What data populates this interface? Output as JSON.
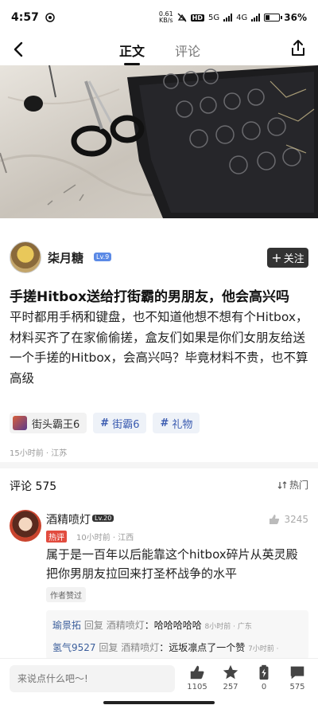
{
  "status_bar": {
    "time": "4:57",
    "net_speed_value": "0.61",
    "net_speed_unit": "KB/s",
    "hd": "HD",
    "sig1": "5G",
    "sig2": "4G",
    "battery": "36%",
    "battery_level": 0.36
  },
  "nav": {
    "tab_active": "正文",
    "tab_inactive": "评论"
  },
  "author": {
    "name": "柒月糖",
    "level": "Lv.9",
    "follow_label": "关注"
  },
  "article": {
    "title": "手搓Hitbox送给打街霸的男朋友，他会高兴吗",
    "body": "平时都用手柄和键盘，也不知道他想不想有个Hitbox，材料买齐了在家偷偷搓，盒友们如果是你们女朋友给送一个手搓的Hitbox，会高兴吗？毕竟材料不贵，也不算高级"
  },
  "tags": {
    "game": "街头霸王6",
    "tag1": "街霸6",
    "tag2": "礼物"
  },
  "post_meta": "15小时前 · 江苏",
  "comments_header": {
    "title": "评论 575",
    "sort": "热门"
  },
  "comment": {
    "user": "酒精喷灯",
    "level": "Lv.20",
    "hot_label": "热评",
    "meta": "10小时前 · 江西",
    "likes": "3245",
    "text": "属于是一百年以后能靠这个hitbox碎片从英灵殿把你男朋友拉回来打圣杯战争的水平",
    "author_liked": "作者赞过"
  },
  "replies": [
    {
      "user": "瑜景拓",
      "verb": "回复",
      "target": "酒精喷灯",
      "text": "：哈哈哈哈哈",
      "meta": "8小时前 · 广东"
    },
    {
      "user": "氢气9527",
      "verb": "回复",
      "target": "酒精喷灯",
      "text": "：远坂凛点了一个赞",
      "meta": "7小时前 ·"
    }
  ],
  "bottom_bar": {
    "input_placeholder": "来说点什么吧～!",
    "likes": "1105",
    "favorites": "257",
    "charges": "0",
    "comments": "575"
  },
  "colors": {
    "accent_blue": "#3a5bb0",
    "hot_red": "#e24c3f",
    "follow_btn": "#333333"
  }
}
